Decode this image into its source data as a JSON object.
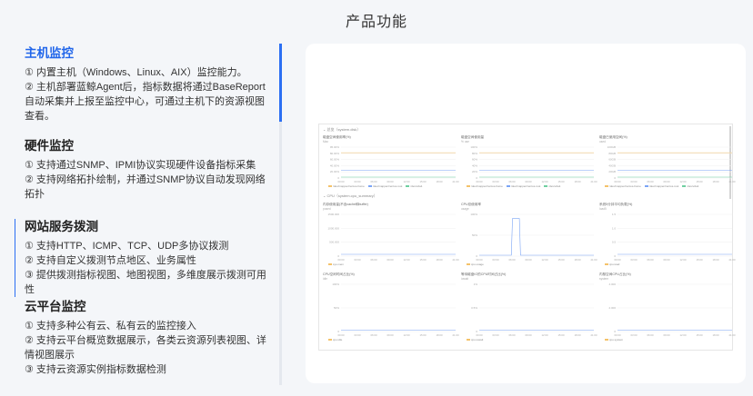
{
  "page_title": "产品功能",
  "features": [
    {
      "title": "主机监控",
      "lines": [
        "① 内置主机（Windows、Linux、AIX）监控能力。",
        "② 主机部署蓝鲸Agent后，指标数据将通过BaseReport自动采集并上报至监控中心，可通过主机下的资源视图查看。"
      ]
    },
    {
      "title": "硬件监控",
      "lines": [
        "① 支持通过SNMP、IPMI协议实现硬件设备指标采集",
        "② 支持网络拓扑绘制，并通过SNMP协议自动发现网络拓扑"
      ]
    },
    {
      "title": "网站服务拨测",
      "lines": [
        "① 支持HTTP、ICMP、TCP、UDP多协议拨测",
        "② 支持自定义拨测节点地区、业务属性",
        "③ 提供拨测指标视图、地图视图，多维度展示拨测可用性"
      ]
    },
    {
      "title": "云平台监控",
      "lines": [
        "① 支持多种公有云、私有云的监控接入",
        "② 支持云平台概览数据展示，各类云资源列表视图、详情视图展示",
        "③ 支持云资源实例指标数据检测"
      ]
    }
  ],
  "dashboard": {
    "group1": "⌄ 总览（system.disk）",
    "group2": "⌄ CPU（system.cpu_summary）",
    "row1": [
      {
        "title": "磁盘空间使用率(%)",
        "unit": "Max",
        "ticks": [
          "95.00%",
          "80.00%",
          "60.00%",
          "40.00%",
          "20.00%",
          "0"
        ],
        "legend": [
          "/dev/mapper/centos-home",
          "/dev/mapper/centos-root",
          "/dev/vda1"
        ]
      },
      {
        "title": "磁盘空间使用量",
        "unit": "%  use",
        "ticks": [
          "100%",
          "80%",
          "60%",
          "40%",
          "20%",
          "0"
        ],
        "legend": [
          "/dev/mapper/centos-home",
          "/dev/mapper/centos-root",
          "/dev/vda1"
        ]
      },
      {
        "title": "磁盘已使用空间(%)",
        "unit": "used",
        "ticks": [
          "100GB",
          "80GB",
          "60GB",
          "40GB",
          "20GB",
          "0"
        ],
        "legend": [
          "/dev/mapper/centos-home",
          "/dev/mapper/centos-root",
          "/dev/vda1"
        ]
      }
    ],
    "row2": [
      {
        "title": "内存使用量(不含cache和buffer)",
        "unit": "pused",
        "ticks": [
          "1500.000",
          "1000.000",
          "500.000",
          "0"
        ],
        "legend": [
          "sys.mem"
        ]
      },
      {
        "title": "CPU总使用率",
        "unit": "usage",
        "ticks": [
          "100%",
          "50%",
          "0"
        ],
        "legend": [
          "cpu.usage"
        ]
      },
      {
        "title": "系统5分钟平均负载(%)",
        "unit": "load5",
        "ticks": [
          "1.5",
          "1.0",
          "0.5",
          "0"
        ],
        "legend": [
          "cpu.load"
        ]
      }
    ],
    "row3": [
      {
        "title": "CPU空闲时间占比(%)",
        "unit": "idle",
        "ticks": [
          "100%",
          "50%",
          "0"
        ],
        "legend": [
          "cpu.idle"
        ]
      },
      {
        "title": "等待磁盘IO的CPU时间占比(%)",
        "unit": "iowait",
        "ticks": [
          "1%",
          "0.5%",
          "0"
        ],
        "legend": [
          "cpu.iowait"
        ]
      },
      {
        "title": "内核空间CPU占比(%)",
        "unit": "system",
        "ticks": [
          "4.000",
          "2.000",
          "0"
        ],
        "legend": [
          "cpu.system"
        ]
      }
    ],
    "xticks": [
      "00:00",
      "03:00",
      "06:00",
      "09:00",
      "12:00",
      "15:00",
      "18:00",
      "21:00"
    ],
    "colors": {
      "accent": "#2b6ff3",
      "line_orange": "#f4c26a",
      "line_blue": "#7aa4f5",
      "line_green": "#6fcfa0",
      "grid": "#efefef"
    }
  }
}
